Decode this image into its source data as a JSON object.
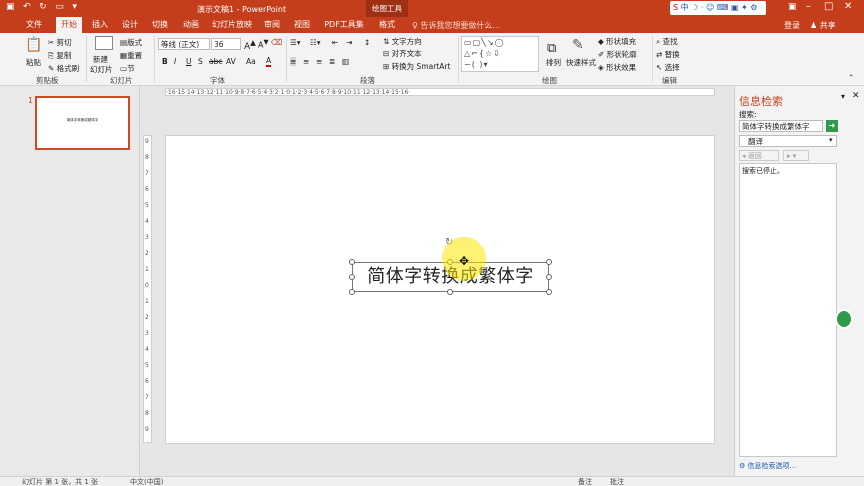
{
  "app": {
    "title": "演示文稿1 - PowerPoint",
    "context_tool": "绘图工具",
    "login": "登录",
    "share": "共享",
    "ime_label": "中"
  },
  "tabs": [
    "文件",
    "开始",
    "插入",
    "设计",
    "切换",
    "动画",
    "幻灯片放映",
    "审阅",
    "视图",
    "PDF工具集",
    "格式"
  ],
  "search_hint": "告诉我您想要做什么...",
  "ribbon": {
    "clipboard": {
      "paste": "粘贴",
      "cut": "剪切",
      "copy": "复制",
      "format_painter": "格式刷",
      "label": "剪贴板"
    },
    "slides": {
      "new_slide": "新建",
      "new_slide2": "幻灯片",
      "layout": "版式",
      "reset": "重置",
      "section": "节",
      "label": "幻灯片"
    },
    "font": {
      "font_name": "等线 (正文)",
      "font_size": "36",
      "bold": "B",
      "italic": "I",
      "underline": "U",
      "shadow": "S",
      "strike": "abc",
      "spacing": "AV",
      "case": "Aa",
      "color_a": "A",
      "label": "字体"
    },
    "paragraph": {
      "text_direction": "文字方向",
      "align_text": "对齐文本",
      "smartart": "转换为 SmartArt",
      "label": "段落"
    },
    "drawing": {
      "arrange": "排列",
      "quick_styles": "快速样式",
      "shape_fill": "形状填充",
      "shape_outline": "形状轮廓",
      "shape_effects": "形状效果",
      "label": "绘图"
    },
    "editing": {
      "find": "查找",
      "replace": "替换",
      "select": "选择",
      "label": "编辑"
    }
  },
  "ruler_h": "·16·15·14·13·12·11·10·9·8·7·6·5·4·3·2·1·0·1·2·3·4·5·6·7·8·9·10·11·12·13·14·15·16·",
  "ruler_v": [
    "9",
    "8",
    "7",
    "6",
    "5",
    "4",
    "3",
    "2",
    "1",
    "0",
    "1",
    "2",
    "3",
    "4",
    "5",
    "6",
    "7",
    "8",
    "9"
  ],
  "thumbnail": {
    "number": "1",
    "text": "简体字转换成繁体字"
  },
  "slide": {
    "textbox": "简体字转换成繁体字"
  },
  "research": {
    "title": "信息检索",
    "search_label": "搜索:",
    "search_value": "简体字转换成繁体字",
    "service": "翻译",
    "back": "返回",
    "status": "搜索已停止。",
    "options": "信息检索选项..."
  },
  "status": {
    "slide_info": "幻灯片 第 1 张，共 1 张",
    "language": "中文(中国)",
    "notes": "备注",
    "comments": "批注"
  }
}
